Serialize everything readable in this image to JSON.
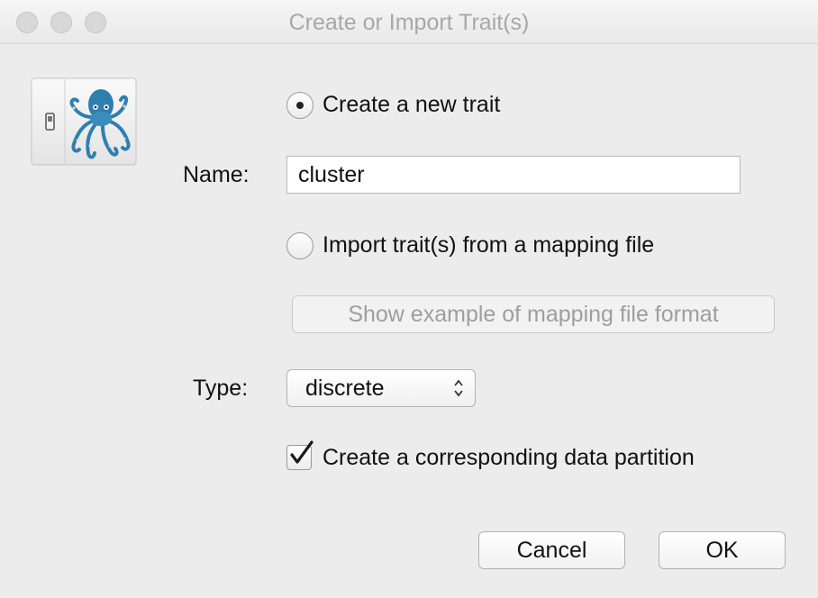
{
  "window": {
    "title": "Create or Import Trait(s)",
    "controls": [
      "close-icon",
      "minimize-icon",
      "zoom-icon"
    ]
  },
  "app_icon": {
    "icon": "octopus-switch-icon",
    "accent": "#2f7fae"
  },
  "options": {
    "create_new_label": "Create a new trait",
    "create_new_selected": true,
    "import_label": "Import trait(s) from a mapping file",
    "import_selected": false
  },
  "name_field": {
    "label": "Name:",
    "value": "cluster"
  },
  "show_example_button": {
    "label": "Show example of mapping file format",
    "enabled": false
  },
  "type_field": {
    "label": "Type:",
    "selected": "discrete",
    "icon": "up-down-chevron-icon"
  },
  "partition_checkbox": {
    "label": "Create a corresponding data partition",
    "checked": true
  },
  "buttons": {
    "cancel_label": "Cancel",
    "ok_label": "OK"
  }
}
